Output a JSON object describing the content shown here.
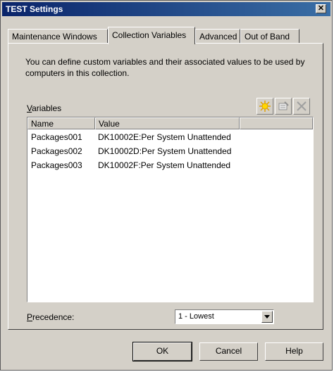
{
  "window": {
    "title": "TEST Settings",
    "close_glyph": "✕"
  },
  "tabs": [
    {
      "label": "Maintenance Windows",
      "active": false
    },
    {
      "label": "Collection Variables",
      "active": true
    },
    {
      "label": "Advanced",
      "active": false
    },
    {
      "label": "Out of Band",
      "active": false
    }
  ],
  "panel": {
    "description": "You can define custom variables and their associated values to be used by computers in this collection.",
    "variables_label_accel": "V",
    "variables_label_rest": "ariables",
    "toolbar": [
      "new-icon",
      "properties-icon",
      "delete-icon"
    ],
    "columns": {
      "name": "Name",
      "value": "Value"
    },
    "rows": [
      {
        "name": "Packages001",
        "value": "DK10002E:Per System Unattended"
      },
      {
        "name": "Packages002",
        "value": "DK10002D:Per System Unattended"
      },
      {
        "name": "Packages003",
        "value": "DK10002F:Per System Unattended"
      }
    ],
    "precedence_label_accel": "P",
    "precedence_label_rest": "recedence:",
    "precedence_value": "1 - Lowest"
  },
  "buttons": {
    "ok": "OK",
    "cancel": "Cancel",
    "help": "Help"
  }
}
